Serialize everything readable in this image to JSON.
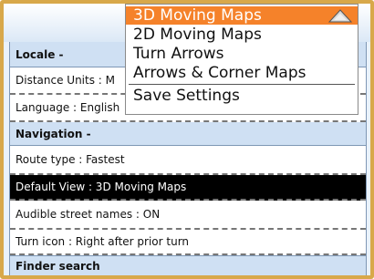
{
  "menu": {
    "items": [
      {
        "label": "3D Moving Maps"
      },
      {
        "label": "2D Moving Maps"
      },
      {
        "label": "Turn Arrows"
      },
      {
        "label": "Arrows & Corner Maps"
      },
      {
        "label": "Save Settings"
      }
    ],
    "highlight_color": "#f5822a"
  },
  "settings": {
    "locale_header": "Locale -",
    "distance_units": "Distance Units : M",
    "language": "Language : English",
    "navigation_header": "Navigation -",
    "route_type": "Route type : Fastest",
    "default_view": "Default View : 3D Moving Maps",
    "audible_street_names": "Audible street names : ON",
    "turn_icon": "Turn icon : Right after prior turn",
    "finder_header": "Finder search"
  },
  "colors": {
    "frame": "#d8a84a",
    "header_bg": "#cfe0f3",
    "selected_bg": "#000000"
  }
}
